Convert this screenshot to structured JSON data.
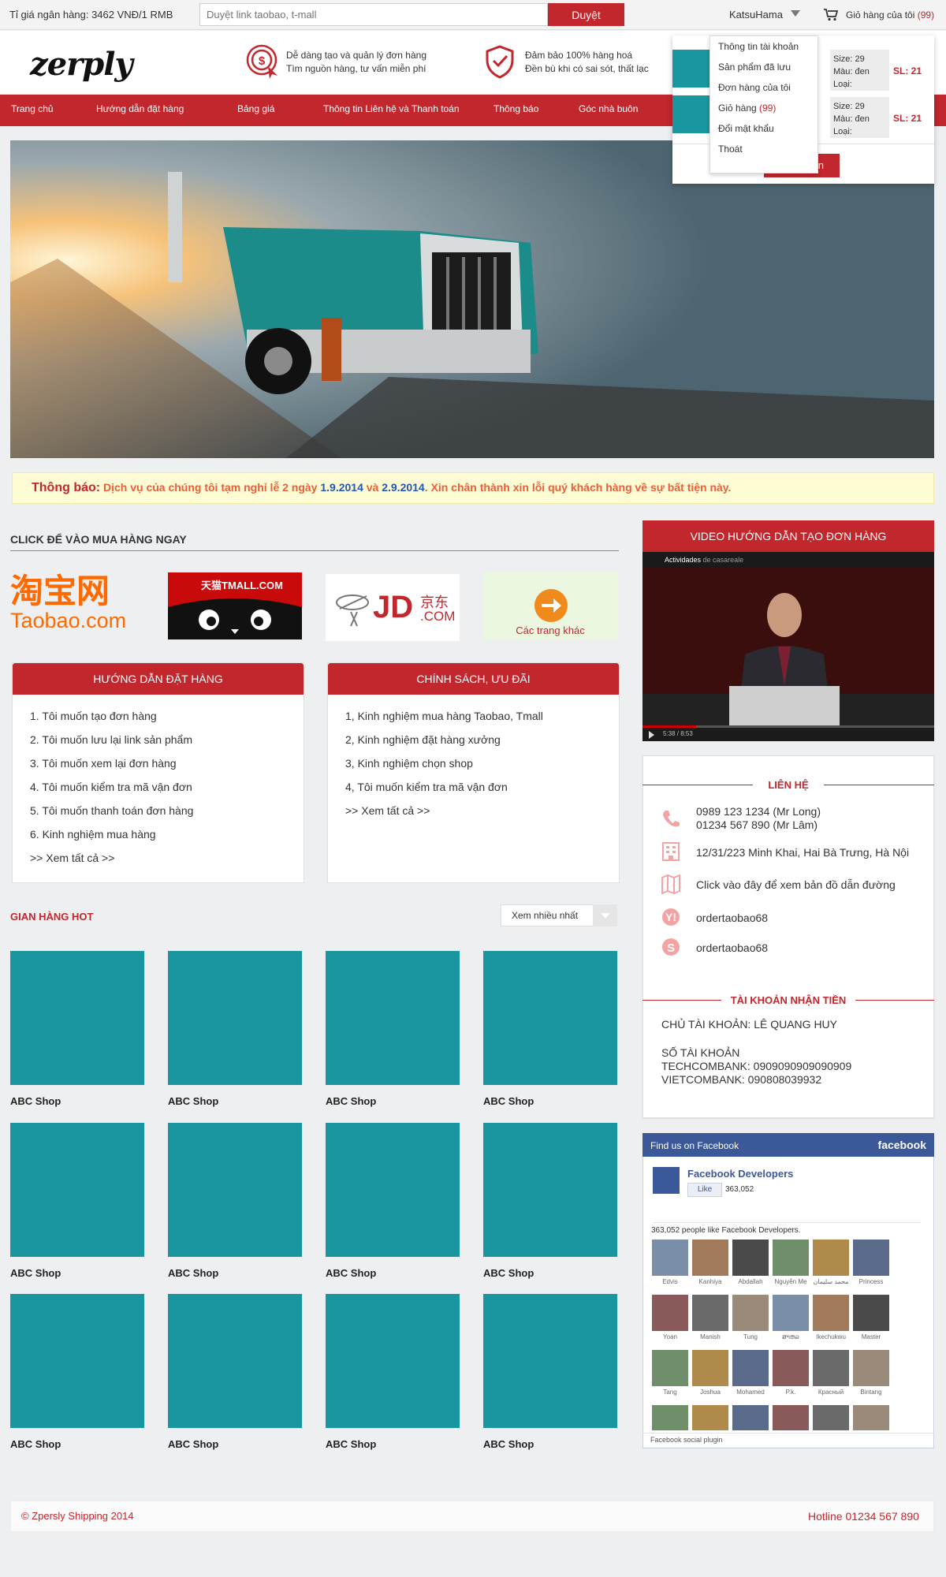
{
  "topbar": {
    "rate": "Tỉ giá ngân hàng: 3462 VNĐ/1 RMB",
    "search_placeholder": "Duyệt link taobao, t-mall",
    "search_button": "Duyệt",
    "username": "KatsuHama",
    "cart_label": "Giỏ hàng của tôi",
    "cart_count": "(99)"
  },
  "header": {
    "logo": "zerply",
    "feature1_line1": "Dễ dàng tạo và quản lý đơn hàng",
    "feature1_line2": "Tìm nguồn hàng, tư vấn miễn phí",
    "feature2_line1": "Đảm bảo 100% hàng hoá",
    "feature2_line2": "Đền bù khi có sai sót, thất lạc"
  },
  "nav": [
    "Trang chủ",
    "Hướng dẫn đặt hàng",
    "Bảng giá",
    "Thông tin Liên hệ và Thanh toán",
    "Thông báo",
    "Góc nhà buôn"
  ],
  "notice": {
    "label": "Thông báo:",
    "t1": " Dịch vụ của chúng tôi tạm nghỉ lễ 2 ngày ",
    "d1": "1.9.2014",
    "t2": " và ",
    "d2": "2.9.2014",
    "t3": ". Xin chân thành xin lỗi quý khách hàng về sự bất tiện này."
  },
  "shops_section": {
    "title": "CLICK ĐỂ VÀO MUA HÀNG NGAY",
    "taobao_cn": "淘宝网",
    "taobao_en": "Taobao.com",
    "tmall": "天猫TMALL.COM",
    "jd": "JD",
    "jd_cn": "京东",
    "jd_com": ".COM",
    "other": "Các trang khác"
  },
  "guide_panel": {
    "title": "HƯỚNG DẪN ĐẶT HÀNG",
    "items": [
      "1. Tôi muốn tạo đơn hàng",
      "2. Tôi muốn lưu lại link sản phẩm",
      "3. Tôi muốn xem lại đơn hàng",
      "4. Tôi muốn kiểm tra mã vận đơn",
      "5. Tôi muốn thanh toán đơn hàng",
      "6. Kinh nghiệm mua hàng",
      ">> Xem tất cả >>"
    ]
  },
  "policy_panel": {
    "title": "CHÍNH SÁCH, ƯU ĐÃI",
    "items": [
      "1, Kinh nghiệm mua hàng Taobao, Tmall",
      "2, Kinh nghiệm đặt hàng xưởng",
      "3, Kinh nghiệm chọn shop",
      "4, Tôi muốn kiểm tra mã vận đơn",
      ">> Xem tất cả >>"
    ]
  },
  "hot": {
    "title": "GIAN HÀNG HOT",
    "sort": "Xem nhiều nhất",
    "shop_name": "ABC Shop"
  },
  "video": {
    "title": "VIDEO HƯỚNG DẪN TẠO ĐƠN HÀNG",
    "channel": "Actividades",
    "by": "de casareale",
    "time": "5:38 / 8:53"
  },
  "contact": {
    "title": "LIÊN HỆ",
    "phone1": "0989 123 1234 (Mr Long)",
    "phone2": "01234 567 890 (Mr Lâm)",
    "address": "12/31/223 Minh Khai, Hai Bà Trưng, Hà Nội",
    "map": "Click vào đây để xem bản đồ dẫn đường",
    "yahoo": "ordertaobao68",
    "skype": "ordertaobao68",
    "bank_title": "TÀI KHOẢN NHẬN TIỀN",
    "owner": "CHỦ TÀI KHOẢN: LÊ QUANG HUY",
    "acc_title": "SỐ TÀI KHOẢN",
    "techcom": "TECHCOMBANK: 0909090909090909",
    "vietcom": "VIETCOMBANK: 090808039932"
  },
  "facebook": {
    "find_us": "Find us on Facebook",
    "brand": "facebook",
    "page": "Facebook Developers",
    "like": "Like",
    "likes": "363,052",
    "people": "363,052 people like Facebook Developers.",
    "names": [
      "Edvis",
      "Kanhiya",
      "Abdallah",
      "Nguyễn Mẹ",
      "محمد سليمان",
      "Princess",
      "Yoan",
      "Manish",
      "Tung",
      "ສາຫລ",
      "Ikechukwu",
      "Master",
      "Tang",
      "Joshua",
      "Mohamed",
      "P.k.",
      "Красный",
      "Bintang"
    ],
    "plugin": "Facebook social plugin"
  },
  "cart_dropdown": {
    "size": "Size: 29",
    "color": "Màu: đen",
    "type": "Loại:",
    "qty": "SL: 21",
    "button": "n"
  },
  "user_menu": [
    "Thông tin tài khoản",
    "Sản phẩm đã lưu",
    "Đơn hàng của tôi",
    "Giỏ hàng",
    "Đổi mật khẩu",
    "Thoát"
  ],
  "user_menu_cart_count": "(99)",
  "footer": {
    "copyright": "© Zpersly Shipping 2014",
    "hotline": "Hotline 01234 567 890"
  },
  "colors": {
    "brand_red": "#c1272d",
    "teal": "#1996a0",
    "notice_bg": "#fdfcd4"
  }
}
